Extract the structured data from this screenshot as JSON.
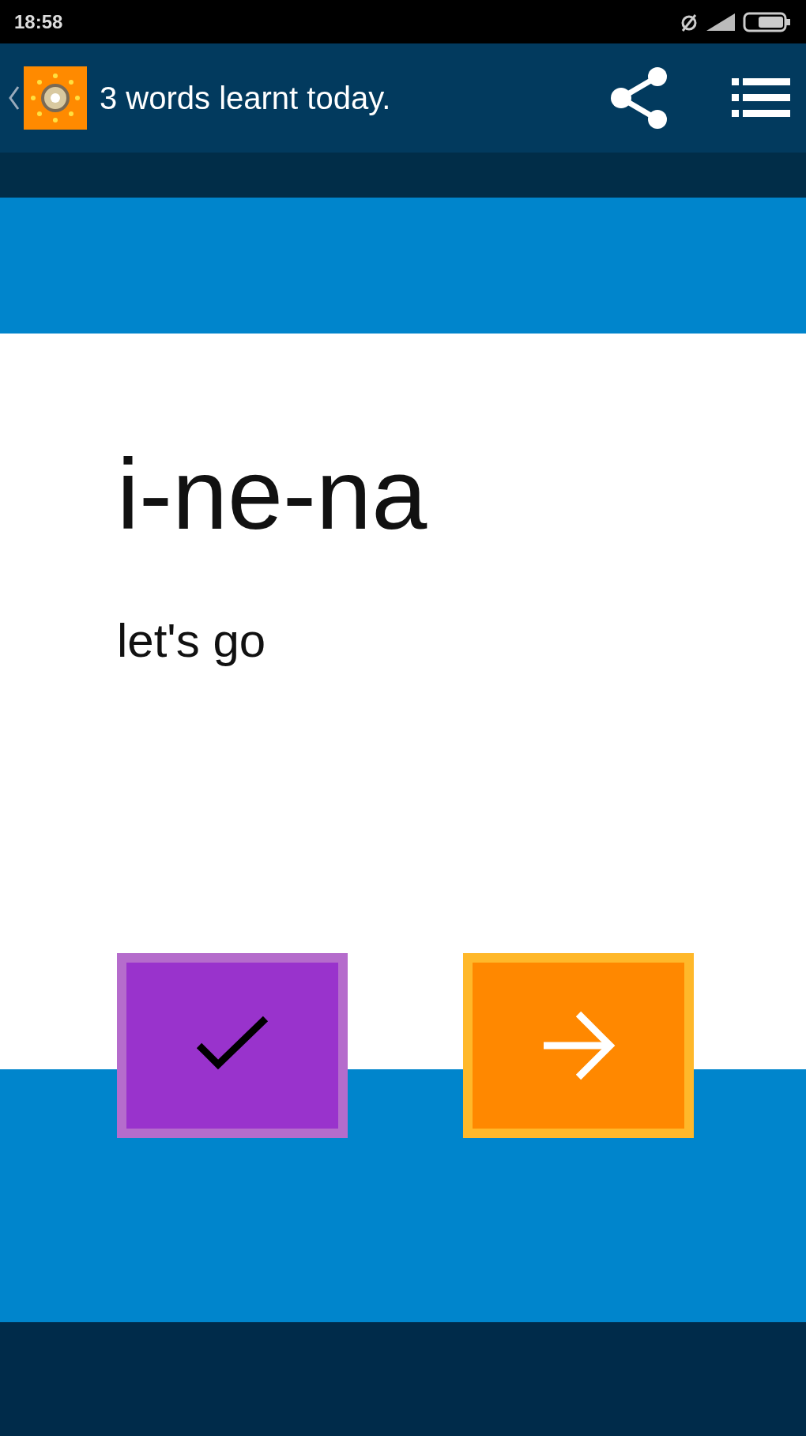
{
  "status_bar": {
    "time": "18:58"
  },
  "app_bar": {
    "title": "3 words learnt today."
  },
  "card": {
    "word": "i-ne-na",
    "meaning": "let's go"
  },
  "actions": [
    {
      "kind": "check"
    },
    {
      "kind": "next"
    }
  ]
}
